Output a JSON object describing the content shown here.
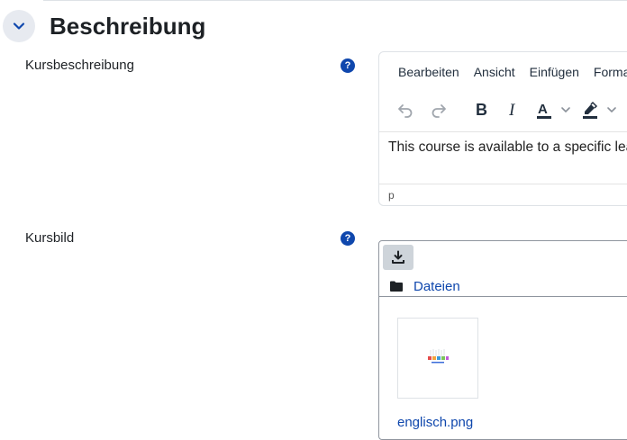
{
  "section": {
    "title": "Beschreibung",
    "collapse_icon": "chevron-down-icon"
  },
  "fields": {
    "description": {
      "label": "Kursbeschreibung",
      "help_icon": "question-icon",
      "help_glyph": "?"
    },
    "image": {
      "label": "Kursbild",
      "help_icon": "question-icon",
      "help_glyph": "?"
    }
  },
  "editor": {
    "menu": [
      "Bearbeiten",
      "Ansicht",
      "Einfügen",
      "Format"
    ],
    "toolbar_icons": [
      "undo-icon",
      "redo-icon",
      "bold-icon",
      "italic-icon",
      "text-color-icon",
      "chevron-down-icon",
      "highlight-color-icon",
      "chevron-down-icon"
    ],
    "content": "This course is available to a specific lea",
    "status_path": "p"
  },
  "filemanager": {
    "download_icon": "download-icon",
    "folder_icon": "folder-icon",
    "path_label": "Dateien",
    "files": [
      {
        "name": "englisch.png"
      }
    ]
  },
  "colors": {
    "accent": "#0f47ad",
    "text": "#1d2125",
    "collapse_bg": "#e7eaf0"
  }
}
